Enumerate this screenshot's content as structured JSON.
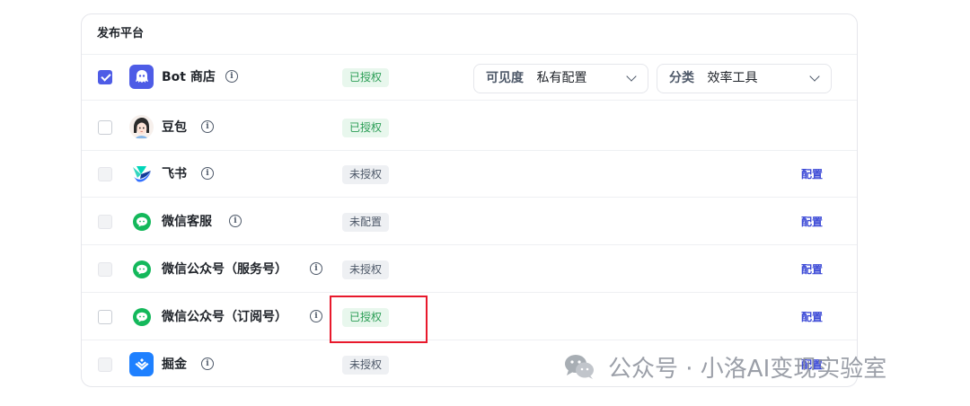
{
  "panel": {
    "title": "发布平台"
  },
  "platforms": [
    {
      "name": "Bot 商店",
      "status": "已授权",
      "status_color": "green",
      "checked": true,
      "action": "",
      "icon": "bot-store-icon"
    },
    {
      "name": "豆包",
      "status": "已授权",
      "status_color": "green",
      "checked": false,
      "action": "",
      "icon": "doubao-avatar-icon"
    },
    {
      "name": "飞书",
      "status": "未授权",
      "status_color": "grey",
      "checked": false,
      "action": "配置",
      "icon": "feishu-icon"
    },
    {
      "name": "微信客服",
      "status": "未配置",
      "status_color": "grey",
      "checked": false,
      "action": "配置",
      "icon": "wechat-icon"
    },
    {
      "name": "微信公众号（服务号）",
      "status": "未授权",
      "status_color": "grey",
      "checked": false,
      "action": "配置",
      "icon": "wechat-icon"
    },
    {
      "name": "微信公众号（订阅号）",
      "status": "已授权",
      "status_color": "green",
      "checked": false,
      "action": "配置",
      "icon": "wechat-icon"
    },
    {
      "name": "掘金",
      "status": "未授权",
      "status_color": "grey",
      "checked": false,
      "action": "配置",
      "icon": "juejin-icon"
    }
  ],
  "bot_store": {
    "visibility": {
      "label": "可见度",
      "value": "私有配置"
    },
    "category": {
      "label": "分类",
      "value": "效率工具"
    }
  },
  "watermark": {
    "text": "公众号 · 小洛AI变现实验室"
  },
  "colors": {
    "accent": "#4e5ce6",
    "link": "#3a48d6",
    "authorized": "#2a9d55",
    "highlight": "#e8192c"
  }
}
